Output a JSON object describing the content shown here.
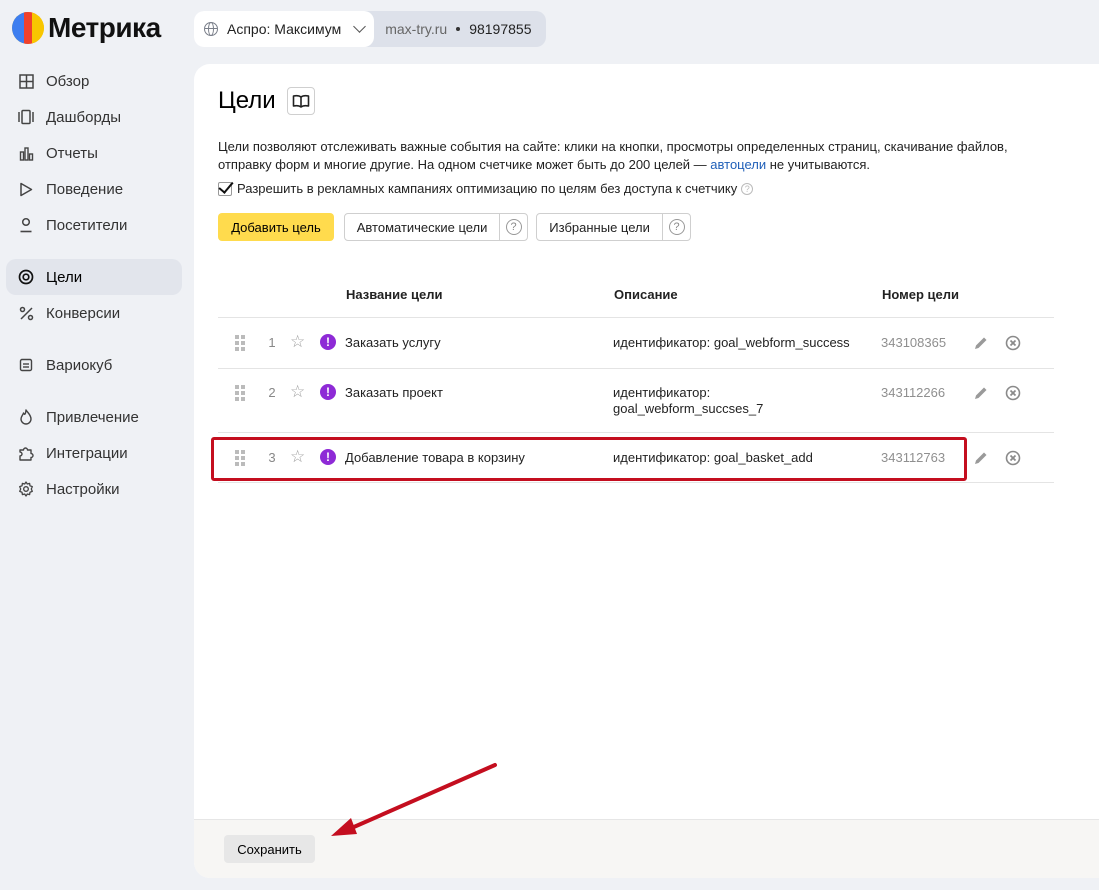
{
  "app": {
    "title": "Метрика"
  },
  "counter": {
    "name": "Аспро: Максимум",
    "site": "max-try.ru",
    "id": "98197855"
  },
  "sidebar": {
    "items": [
      {
        "label": "Обзор",
        "icon": "grid-icon"
      },
      {
        "label": "Дашборды",
        "icon": "dashboards-icon"
      },
      {
        "label": "Отчеты",
        "icon": "bar-chart-icon"
      },
      {
        "label": "Поведение",
        "icon": "play-icon"
      },
      {
        "label": "Посетители",
        "icon": "user-icon"
      },
      {
        "label": "Цели",
        "icon": "target-icon",
        "active": true
      },
      {
        "label": "Конверсии",
        "icon": "percent-icon"
      },
      {
        "label": "Вариокуб",
        "icon": "variocube-icon"
      },
      {
        "label": "Привлечение",
        "icon": "fire-icon"
      },
      {
        "label": "Интеграции",
        "icon": "puzzle-icon"
      },
      {
        "label": "Настройки",
        "icon": "gear-icon"
      }
    ]
  },
  "page": {
    "title": "Цели",
    "description_part1": "Цели позволяют отслеживать важные события на сайте: клики на кнопки, просмотры определенных страниц, скачивание файлов, отправку форм и многие другие. На одном счетчике может быть до 200 целей — ",
    "description_link": "автоцели",
    "description_part2": " не учитываются.",
    "checkbox_label": "Разрешить в рекламных кампаниях оптимизацию по целям без доступа к счетчику",
    "checkbox_checked": true,
    "add_goal_button": "Добавить цель",
    "auto_goals_button": "Автоматические цели",
    "favorite_goals_button": "Избранные цели"
  },
  "table": {
    "headers": {
      "name": "Название цели",
      "description": "Описание",
      "number": "Номер цели"
    },
    "rows": [
      {
        "index": "1",
        "name": "Заказать услугу",
        "description": "идентификатор: goal_webform_success",
        "number": "343108365"
      },
      {
        "index": "2",
        "name": "Заказать проект",
        "description": "идентификатор:",
        "description_line2": "goal_webform_succses_7",
        "number": "343112266"
      },
      {
        "index": "3",
        "name": "Добавление товара в корзину",
        "description": "идентификатор: goal_basket_add",
        "number": "343112763"
      }
    ]
  },
  "footer": {
    "save_button": "Сохранить"
  },
  "colors": {
    "accent_yellow": "#ffdb4d",
    "highlight_red": "#c40e1f",
    "warn_purple": "#8e2ad6",
    "link_blue": "#1f5fb8"
  }
}
